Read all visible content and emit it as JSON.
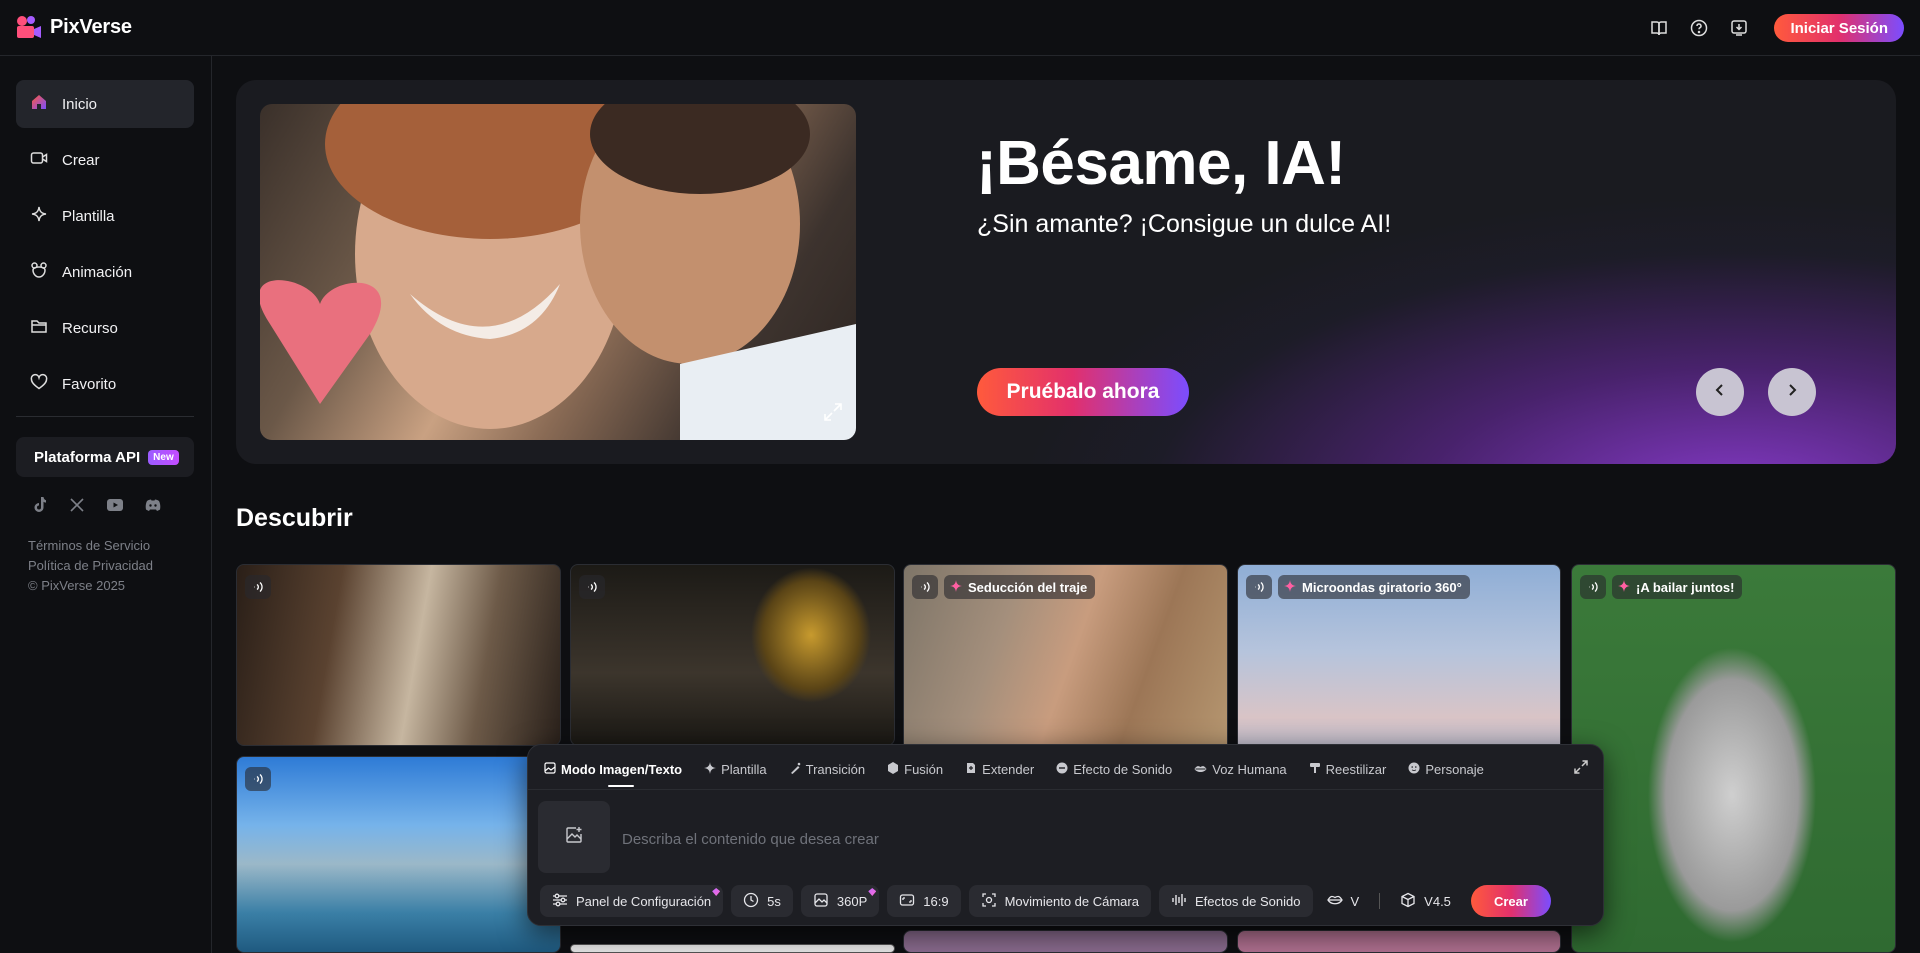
{
  "app": {
    "name": "PixVerse"
  },
  "header": {
    "login_label": "Iniciar Sesión",
    "icons": [
      "book-icon",
      "help-icon",
      "download-app-icon"
    ]
  },
  "sidebar": {
    "items": [
      {
        "label": "Inicio",
        "icon": "home-icon",
        "active": true
      },
      {
        "label": "Crear",
        "icon": "video-camera-icon"
      },
      {
        "label": "Plantilla",
        "icon": "sparkle-icon"
      },
      {
        "label": "Animación",
        "icon": "animation-icon"
      },
      {
        "label": "Recurso",
        "icon": "folder-icon"
      },
      {
        "label": "Favorito",
        "icon": "heart-icon"
      }
    ],
    "api_label": "Plataforma API",
    "api_badge": "New",
    "socials": [
      "tiktok-icon",
      "x-icon",
      "youtube-icon",
      "discord-icon"
    ],
    "legal": [
      "Términos de Servicio",
      "Política de Privacidad",
      "© PixVerse 2025"
    ]
  },
  "hero": {
    "title": "¡Bésame, IA!",
    "subtitle": "¿Sin amante? ¡Consigue un dulce AI!",
    "cta": "Pruébalo ahora"
  },
  "discover": {
    "title": "Descubrir",
    "cards": [
      {
        "tag": ""
      },
      {
        "tag": ""
      },
      {
        "tag": "Seducción del traje"
      },
      {
        "tag": "Microondas giratorio 360°"
      },
      {
        "tag": "¡A bailar juntos!"
      },
      {
        "tag": ""
      }
    ]
  },
  "creator": {
    "tabs": [
      {
        "label": "Modo Imagen/Texto",
        "active": true
      },
      {
        "label": "Plantilla"
      },
      {
        "label": "Transición"
      },
      {
        "label": "Fusión"
      },
      {
        "label": "Extender"
      },
      {
        "label": "Efecto de Sonido"
      },
      {
        "label": "Voz Humana"
      },
      {
        "label": "Reestilizar"
      },
      {
        "label": "Personaje"
      }
    ],
    "prompt_placeholder": "Describa el contenido que desea crear",
    "settings": {
      "panel": "Panel de Configuración",
      "duration": "5s",
      "quality": "360P",
      "ratio": "16:9",
      "camera": "Movimiento de Cámara",
      "sound": "Efectos de Sonido",
      "voice_partial": "V",
      "version": "V4.5"
    },
    "create_label": "Crear"
  },
  "colors": {
    "accent_start": "#ff5a3c",
    "accent_mid": "#e2306c",
    "accent_end": "#7b4dff",
    "bg": "#0e0f12"
  }
}
